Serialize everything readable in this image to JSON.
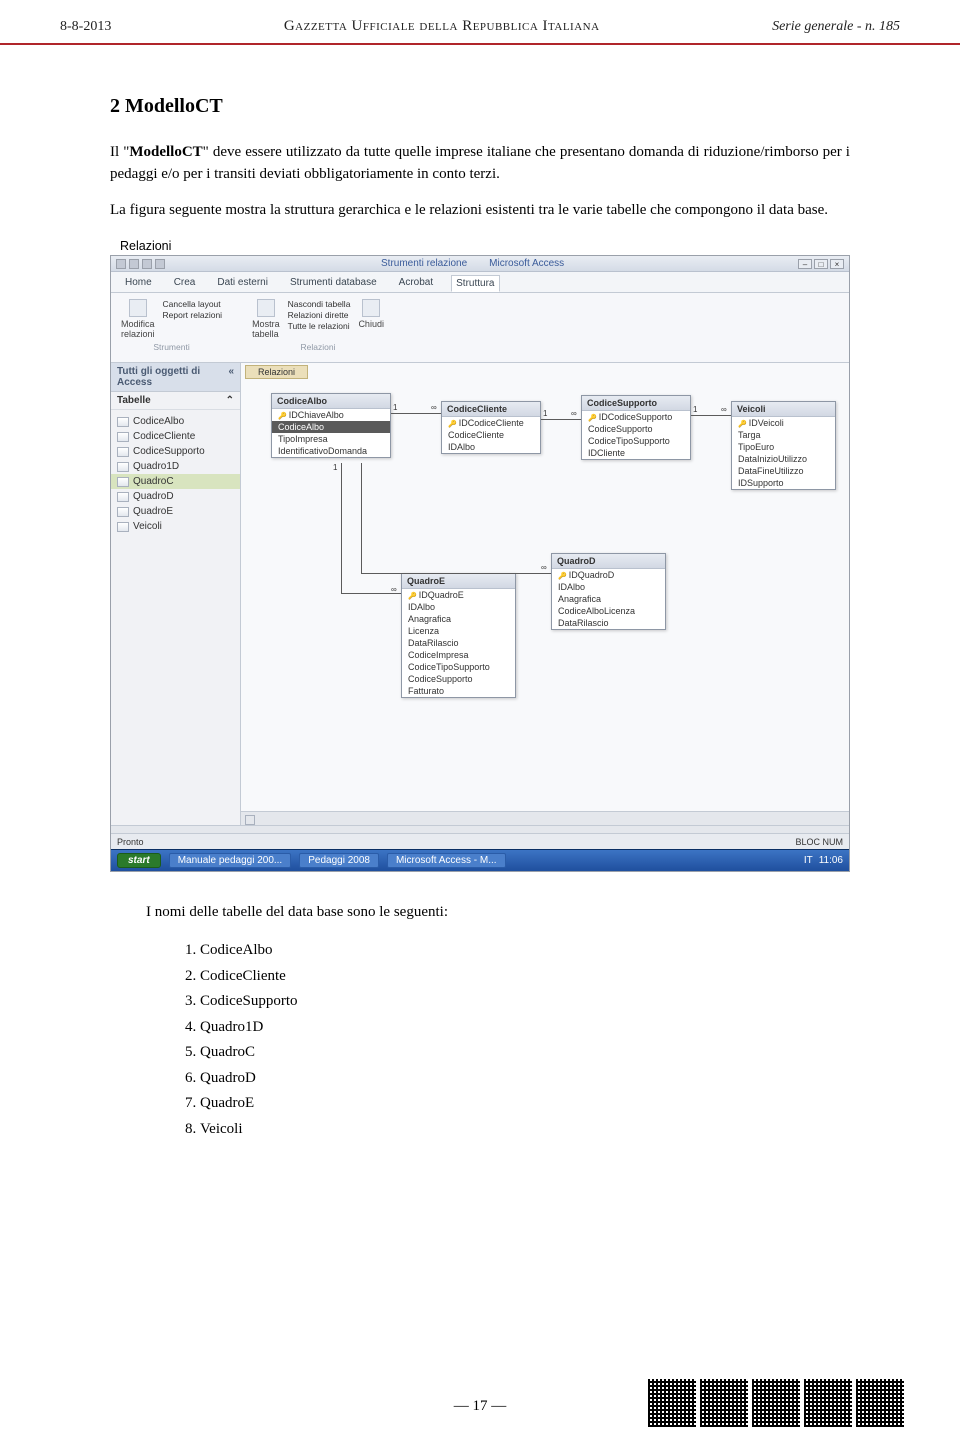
{
  "header": {
    "left": "8-8-2013",
    "center": "Gazzetta Ufficiale della Repubblica Italiana",
    "right": "Serie generale - n. 185"
  },
  "section_title": "2  ModelloCT",
  "para1_a": "Il \"",
  "para1_b": "ModelloCT",
  "para1_c": "\" deve essere utilizzato da tutte quelle imprese italiane che presentano domanda di riduzione/rimborso per i pedaggi e/o per i transiti deviati obbligatoriamente in conto terzi.",
  "para2": "La figura seguente mostra la struttura gerarchica e le relazioni esistenti tra le varie tabelle che compongono il data base.",
  "relazioni_label": "Relazioni",
  "access": {
    "title_tool": "Strumenti relazione",
    "title_app": "Microsoft Access",
    "tabs": {
      "home": "Home",
      "crea": "Crea",
      "dati": "Dati esterni",
      "strdb": "Strumenti database",
      "acrobat": "Acrobat",
      "struttura": "Struttura"
    },
    "ribbon": {
      "modifica": "Modifica\nrelazioni",
      "cancella": "Cancella layout",
      "report": "Report relazioni",
      "strumenti": "Strumenti",
      "mostra": "Mostra\ntabella",
      "nascondi": "Nascondi tabella",
      "dirette": "Relazioni dirette",
      "tutte": "Tutte le relazioni",
      "chiudi": "Chiudi",
      "relazioni": "Relazioni"
    },
    "nav_title": "Tutti gli oggetti di Access",
    "nav_sub": "Tabelle",
    "nav_items": [
      "CodiceAlbo",
      "CodiceCliente",
      "CodiceSupporto",
      "Quadro1D",
      "QuadroC",
      "QuadroD",
      "QuadroE",
      "Veicoli"
    ],
    "rel_tab": "Relazioni",
    "boxes": {
      "CodiceAlbo": {
        "fields": [
          "IDChiaveAlbo",
          "CodiceAlbo",
          "TipoImpresa",
          "IdentificativoDomanda"
        ]
      },
      "CodiceCliente": {
        "fields": [
          "IDCodiceCliente",
          "CodiceCliente",
          "IDAlbo"
        ]
      },
      "CodiceSupporto": {
        "fields": [
          "IDCodiceSupporto",
          "CodiceSupporto",
          "CodiceTipoSupporto",
          "IDCliente"
        ]
      },
      "Veicoli": {
        "fields": [
          "IDVeicoli",
          "Targa",
          "TipoEuro",
          "DataInizioUtilizzo",
          "DataFineUtilizzo",
          "IDSupporto"
        ]
      },
      "QuadroE": {
        "fields": [
          "IDQuadroE",
          "IDAlbo",
          "Anagrafica",
          "Licenza",
          "DataRilascio",
          "CodiceImpresa",
          "CodiceTipoSupporto",
          "CodiceSupporto",
          "Fatturato"
        ]
      },
      "QuadroD": {
        "fields": [
          "IDQuadroD",
          "IDAlbo",
          "Anagrafica",
          "CodiceAlboLicenza",
          "DataRilascio"
        ]
      }
    },
    "status": "Pronto",
    "bloc": "BLOC NUM",
    "taskbar": {
      "start": "start",
      "t1": "Manuale pedaggi 200...",
      "t2": "Pedaggi 2008",
      "t3": "Microsoft Access - M...",
      "time": "11:06",
      "lang": "IT"
    }
  },
  "after_text": "I nomi delle tabelle del data base sono le seguenti:",
  "table_list": [
    "CodiceAlbo",
    "CodiceCliente",
    "CodiceSupporto",
    "Quadro1D",
    "QuadroC",
    "QuadroD",
    "QuadroE",
    "Veicoli"
  ],
  "footer": "—  17  —"
}
